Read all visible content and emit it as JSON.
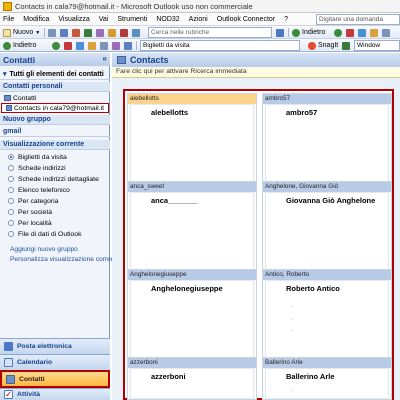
{
  "window": {
    "title": "Contacts in cala79@hotmail.it - Microsoft Outlook uso non commerciale"
  },
  "menubar": {
    "items": [
      "File",
      "Modifica",
      "Visualizza",
      "Vai",
      "Strumenti",
      "NOD32",
      "Azioni",
      "Outlook Connector",
      "?"
    ],
    "search_placeholder": "Digitare una domanda"
  },
  "toolbar1": {
    "new_label": "Nuovo",
    "combo_placeholder": "Cerca nelle rubriche",
    "back_label": "Indietro"
  },
  "toolbar2": {
    "back_label": "Indietro",
    "view_combo": "Biglietti da visita",
    "snagit_label": "SnagIt",
    "window_combo": "Window"
  },
  "navigation": {
    "header": "Contatti",
    "collapse_glyph": "«",
    "all_items": "Tutti gli elementi dei contatti",
    "section_personal": "Contatti personali",
    "folders": [
      {
        "label": "Contatti",
        "selected": false
      },
      {
        "label": "Contacts in cala79@hotmail.it",
        "selected": true
      }
    ],
    "new_group": "Nuovo gruppo",
    "gmail": "gmail",
    "section_view": "Visualizzazione corrente",
    "views": [
      {
        "label": "Biglietti da visita",
        "checked": true
      },
      {
        "label": "Schede indirizzi",
        "checked": false
      },
      {
        "label": "Schede indirizzi dettagliate",
        "checked": false
      },
      {
        "label": "Elenco telefonico",
        "checked": false
      },
      {
        "label": "Per categoria",
        "checked": false
      },
      {
        "label": "Per società",
        "checked": false
      },
      {
        "label": "Per località",
        "checked": false
      },
      {
        "label": "File di dati di Outlook",
        "checked": false
      }
    ],
    "links": [
      "Aggiungi nuovo gruppo",
      "Personalizza visualizzazione corrente"
    ],
    "buttons": [
      {
        "label": "Posta elettronica",
        "selected": false
      },
      {
        "label": "Calendario",
        "selected": false
      },
      {
        "label": "Contatti",
        "selected": true
      },
      {
        "label": "Attività",
        "selected": false
      }
    ]
  },
  "content": {
    "header": "Contacts",
    "info_bar": "Fare clic qui per attivare Ricerca immediata",
    "cards": [
      {
        "header": "alebellotts",
        "name": "alebellotts",
        "active": true
      },
      {
        "header": "ambro57",
        "name": "ambro57",
        "active": false
      },
      {
        "header": "anca_sweet",
        "name": "anca_______",
        "active": false
      },
      {
        "header": "Anghelone, Giovanna Giò",
        "name": "Giovanna Giò Anghelone",
        "active": false
      },
      {
        "header": "Anghelonegiuseppe",
        "name": "Anghelonegiuseppe",
        "active": false
      },
      {
        "header": "Antico, Roberto",
        "name": "Roberto Antico",
        "active": false
      },
      {
        "header": "azzerboni",
        "name": "azzerboni",
        "active": false
      },
      {
        "header": "Ballerino Arle",
        "name": "Ballerino Arle",
        "active": false
      }
    ]
  },
  "colors": {
    "highlight_border": "#b00000",
    "outlook_blue": "#15428b",
    "selected_card_header": "#fbd38b"
  }
}
